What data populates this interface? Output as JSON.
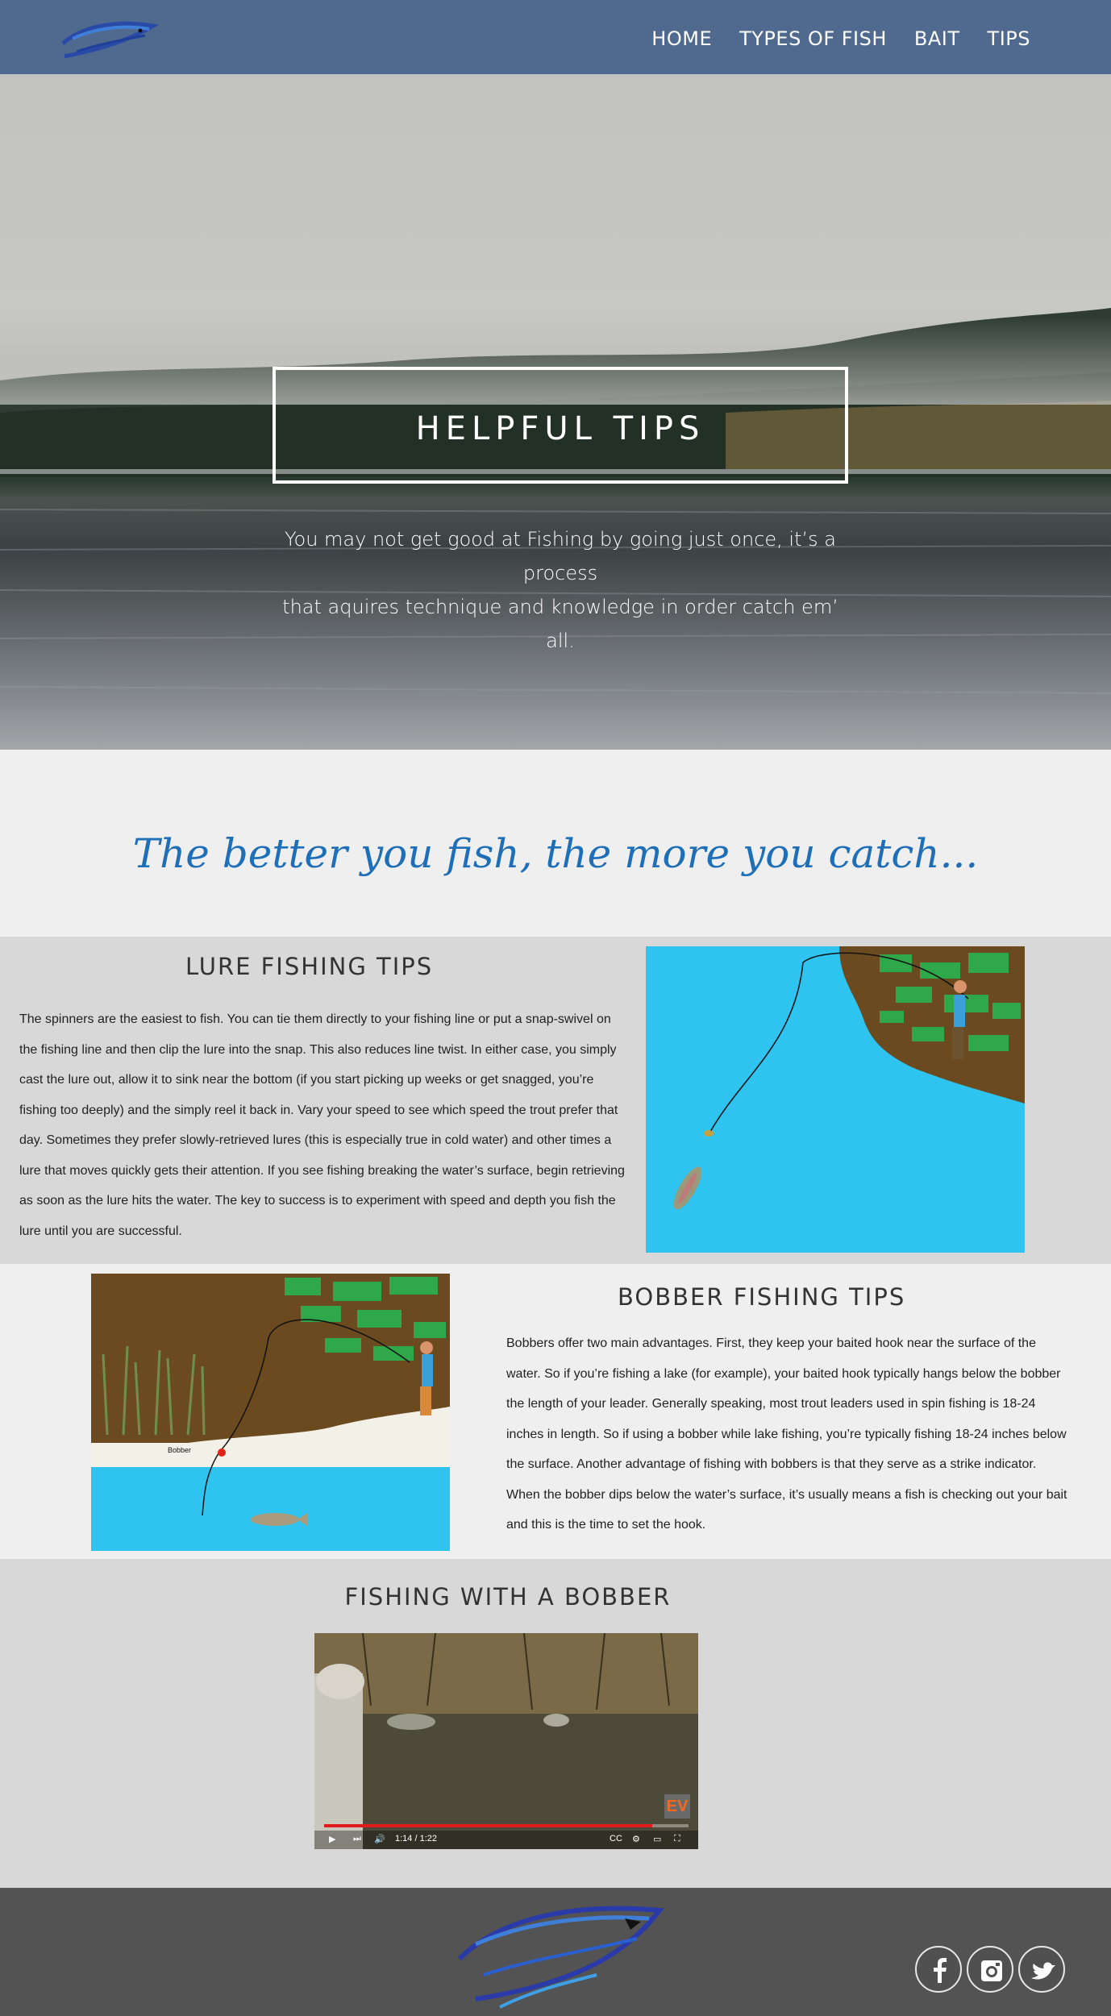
{
  "nav": {
    "logo_icon": "fish-logo-icon",
    "items": [
      "HOME",
      "TYPES OF FISH",
      "BAIT",
      "TIPS"
    ]
  },
  "hero": {
    "title": "HELPFUL TIPS",
    "subtitle_line1": "You may not get good at Fishing by going just once, it’s a process",
    "subtitle_line2": "that aquires technique and knowledge in order catch em’ all."
  },
  "tagline": "The better you fish, the more you catch...",
  "lure": {
    "heading": "LURE FISHING TIPS",
    "body": "The spinners are the easiest to fish. You can tie them directly to your fishing line or put a snap-swivel on the fishing line and then clip the lure into the snap. This also reduces line twist. In either case, you simply cast the lure out, allow it to sink near the bottom (if you start picking up weeks or get snagged, you’re fishing too deeply) and the simply reel it back in. Vary your speed to see which speed the trout prefer that day. Sometimes they prefer slowly-retrieved lures (this is especially true in cold water) and other times a lure that moves quickly gets their attention. If you see fishing breaking the water’s surface, begin retrieving as soon as the lure hits the water. The key to success is to experiment with speed and depth you fish the lure until you are successful."
  },
  "bobber": {
    "heading": "BOBBER FISHING TIPS",
    "illus_label": "Bobber",
    "body": "Bobbers offer two main advantages.  First, they keep your baited hook near the surface of the water.  So if you’re fishing a lake (for example), your baited hook typically hangs below the bobber the length of your leader.  Generally speaking, most trout leaders used in spin fishing is 18-24 inches in length.  So if using a bobber while lake fishing, you’re typically fishing 18-24 inches below the surface. Another advantage of fishing with bobbers is that they serve as a strike indicator. When the bobber dips below the water’s surface, it’s usually means a fish is checking out your bait and this is the time to set the hook."
  },
  "video": {
    "heading": "FISHING WITH A BOBBER",
    "time": "1:14 / 1:22",
    "progress": 0.9,
    "badge": "EV"
  },
  "footer": {
    "social": [
      "facebook-icon",
      "instagram-icon",
      "twitter-icon"
    ]
  },
  "colors": {
    "nav": "#4f6a8e",
    "tagline": "#1f6fb8",
    "water": "#2fc3ef",
    "ground": "#6b4a1f",
    "foliage": "#2fa84a",
    "footer": "#535353"
  }
}
